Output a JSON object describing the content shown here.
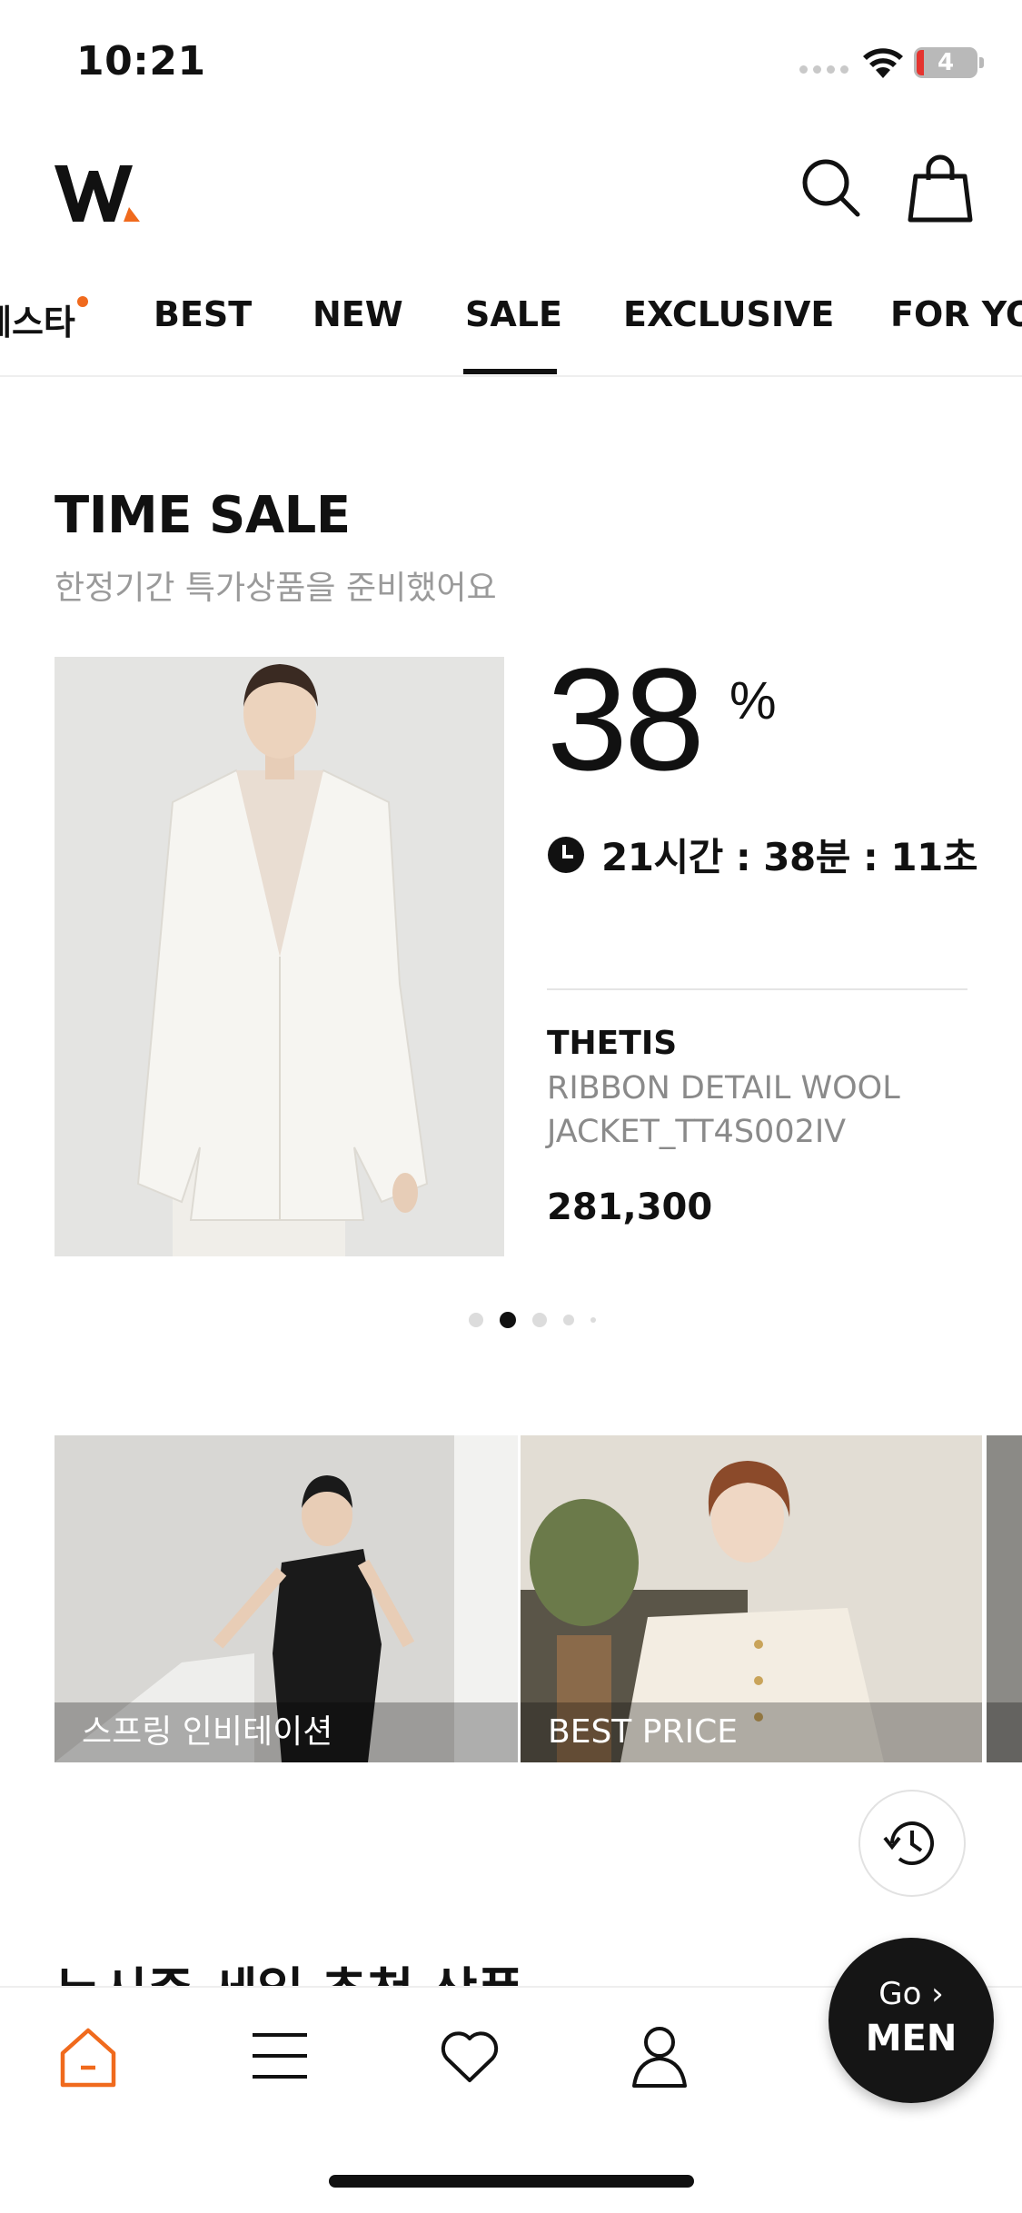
{
  "status_bar": {
    "time": "10:21",
    "battery": "4"
  },
  "header": {
    "logo_icon": "w-concept-logo",
    "search_icon": "search-icon",
    "bag_icon": "shopping-bag-icon"
  },
  "tabs": [
    {
      "label": "페스타",
      "has_dot": true
    },
    {
      "label": "BEST"
    },
    {
      "label": "NEW"
    },
    {
      "label": "SALE",
      "selected": true
    },
    {
      "label": "EXCLUSIVE"
    },
    {
      "label": "FOR YOU"
    }
  ],
  "time_sale": {
    "title": "TIME SALE",
    "subtitle": "한정기간 특가상품을 준비했어요",
    "discount": "38",
    "percent_sign": "%",
    "timer": "21시간 : 38분 : 11초",
    "brand": "THETIS",
    "product_name": "RIBBON DETAIL WOOL JACKET_TT4S002IV",
    "price": "281,300",
    "pager": {
      "count": 5,
      "active_index": 1
    }
  },
  "banners": [
    {
      "label": "스프링 인비테이션"
    },
    {
      "label": "BEST PRICE"
    }
  ],
  "next_section_title": "누시즌 세일 추천 상품",
  "bottom_nav": {
    "items": [
      "home-icon",
      "menu-icon",
      "heart-icon",
      "user-icon"
    ]
  },
  "go_men": {
    "go": "Go ›",
    "men": "MEN"
  },
  "colors": {
    "accent": "#f06a1d",
    "text": "#111111",
    "muted": "#9a9a9a"
  }
}
